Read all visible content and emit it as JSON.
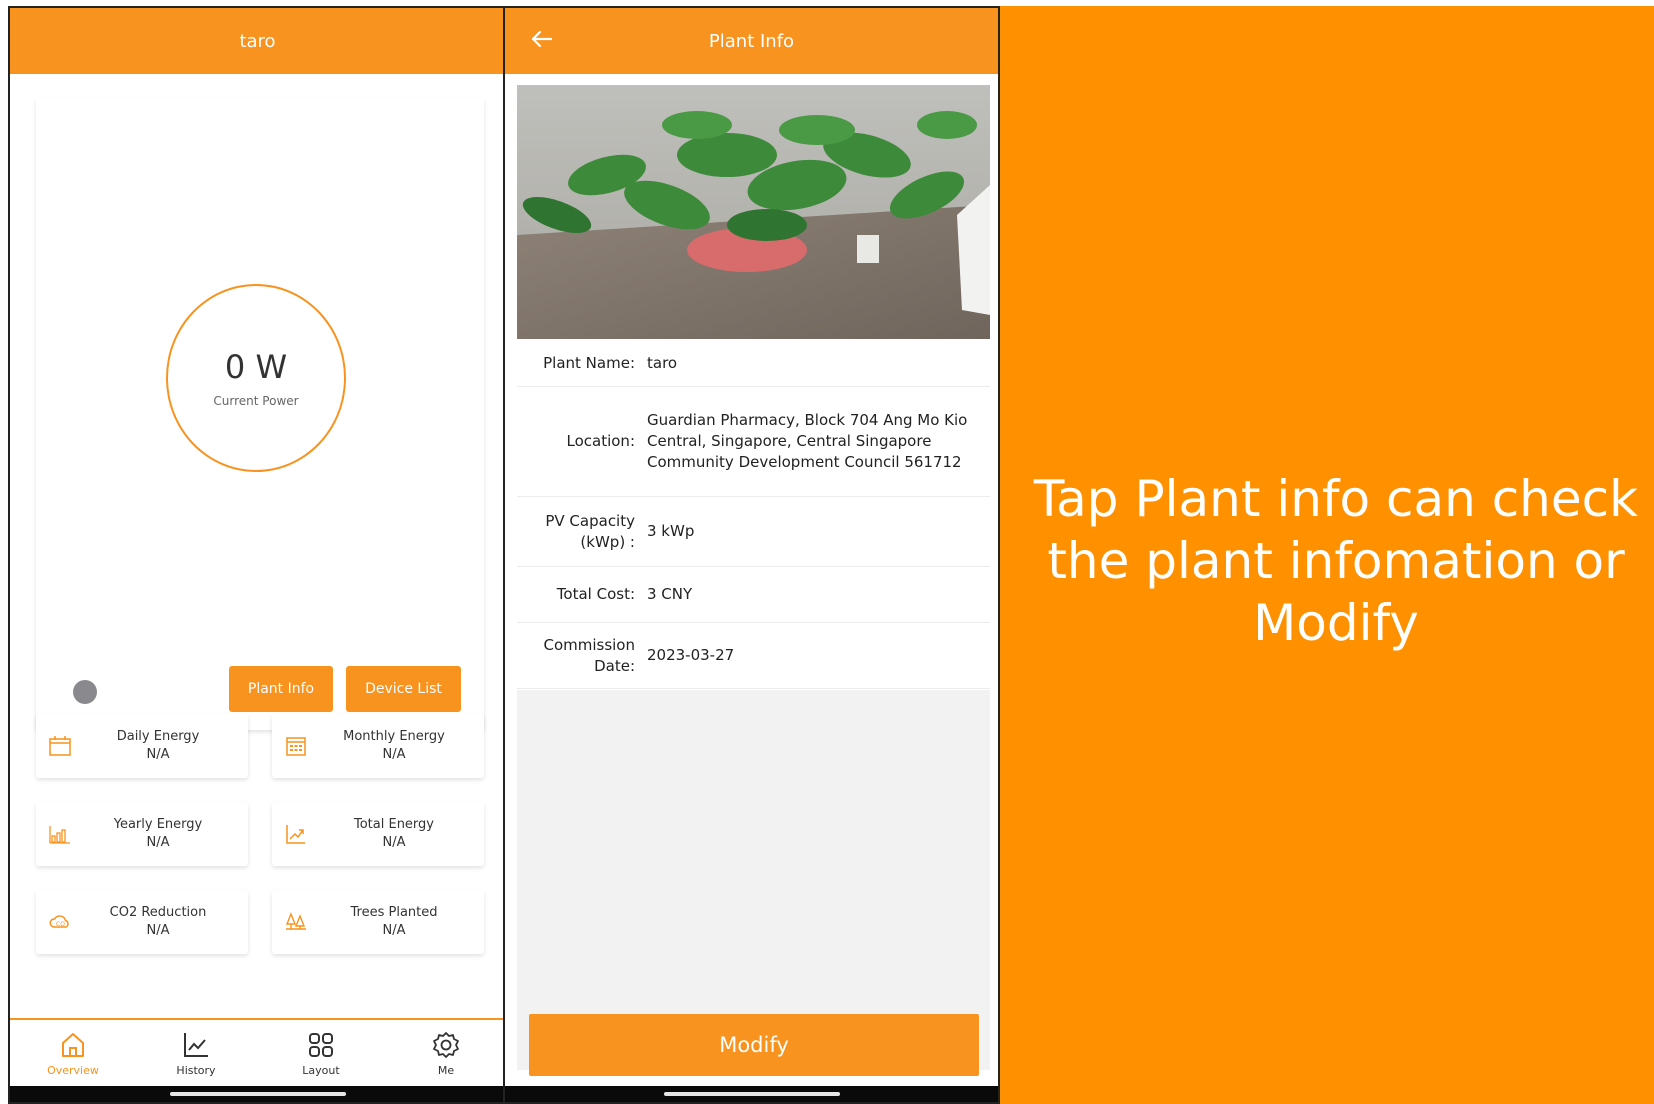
{
  "overview": {
    "title": "taro",
    "power_value": "0 W",
    "power_label": "Current Power",
    "plant_info_btn": "Plant Info",
    "device_list_btn": "Device List",
    "stats": [
      {
        "label": "Daily Energy",
        "value": "N/A",
        "icon": "calendar-icon"
      },
      {
        "label": "Monthly Energy",
        "value": "N/A",
        "icon": "calendar-grid-icon"
      },
      {
        "label": "Yearly Energy",
        "value": "N/A",
        "icon": "bar-chart-icon"
      },
      {
        "label": "Total Energy",
        "value": "N/A",
        "icon": "trend-chart-icon"
      },
      {
        "label": "CO2 Reduction",
        "value": "N/A",
        "icon": "co2-cloud-icon"
      },
      {
        "label": "Trees Planted",
        "value": "N/A",
        "icon": "trees-icon"
      }
    ],
    "tabs": [
      {
        "label": "Overview",
        "icon": "home-icon",
        "active": true
      },
      {
        "label": "History",
        "icon": "line-chart-icon"
      },
      {
        "label": "Layout",
        "icon": "grid-icon"
      },
      {
        "label": "Me",
        "icon": "gear-icon"
      }
    ]
  },
  "plant_info": {
    "title": "Plant Info",
    "rows": [
      {
        "key": "Plant Name:",
        "value": "taro"
      },
      {
        "key": "Location:",
        "value": "Guardian Pharmacy, Block 704 Ang Mo Kio Central, Singapore, Central Singapore Community Development Council 561712"
      },
      {
        "key": "PV Capacity (kWp) :",
        "value": "3 kWp"
      },
      {
        "key": "Total Cost:",
        "value": "3 CNY"
      },
      {
        "key": "Commission Date:",
        "value": "2023-03-27"
      }
    ],
    "modify_btn": "Modify"
  },
  "caption": "Tap Plant info can check the plant infomation or Modify",
  "colors": {
    "accent": "#f7931e",
    "panel": "#ff9000"
  }
}
